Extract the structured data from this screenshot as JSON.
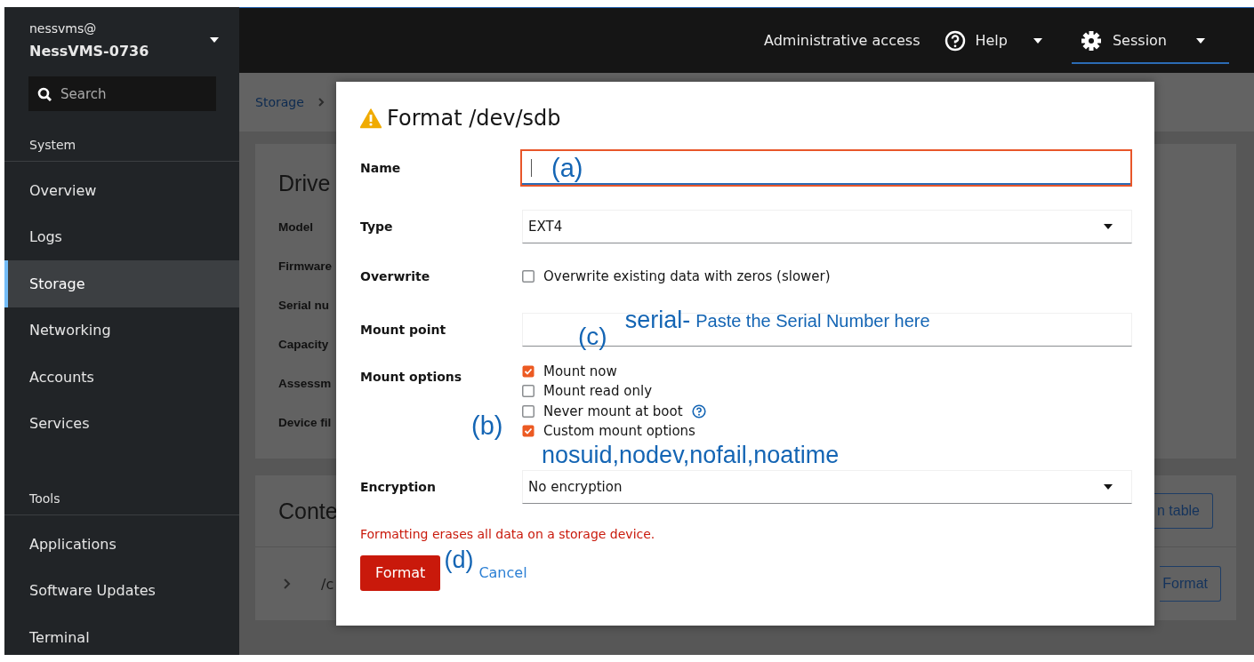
{
  "sidebar": {
    "user": "nessvms@",
    "host": "NessVMS-0736",
    "search": {
      "placeholder": "Search"
    },
    "sections": [
      {
        "heading": "System",
        "items": [
          {
            "label": "Overview",
            "selected": false
          },
          {
            "label": "Logs",
            "selected": false
          },
          {
            "label": "Storage",
            "selected": true
          },
          {
            "label": "Networking",
            "selected": false
          },
          {
            "label": "Accounts",
            "selected": false
          },
          {
            "label": "Services",
            "selected": false
          }
        ]
      },
      {
        "heading": "Tools",
        "items": [
          {
            "label": "Applications",
            "selected": false
          },
          {
            "label": "Software Updates",
            "selected": false
          },
          {
            "label": "Terminal",
            "selected": false
          }
        ]
      }
    ]
  },
  "topbar": {
    "admin": "Administrative access",
    "help": "Help",
    "session": "Session"
  },
  "page": {
    "breadcrumb": "Storage",
    "drive_card": {
      "title": "Drive",
      "labels": [
        "Model",
        "Firmware",
        "Serial nu",
        "Capacity",
        "Assessm",
        "Device fil"
      ]
    },
    "content_card": {
      "title": "Conte",
      "row": "/c",
      "buttons": [
        "n table",
        "Format"
      ]
    }
  },
  "dialog": {
    "title": "Format /dev/sdb",
    "fields": [
      {
        "kind": "text",
        "label": "Name",
        "invalid": true,
        "annotations": [
          "(a)"
        ]
      },
      {
        "kind": "select",
        "label": "Type",
        "value": "EXT4"
      },
      {
        "kind": "checkbox",
        "label": "Overwrite",
        "option": "Overwrite existing data with zeros (slower)",
        "checked": false
      },
      {
        "kind": "text",
        "label": "Mount point",
        "invalid": false,
        "annotations": [
          "(c)",
          "serial-",
          "Paste the Serial Number here"
        ]
      },
      {
        "kind": "checklist",
        "label": "Mount options",
        "annotation": "(b)",
        "note": "nosuid,nodev,nofail,noatime",
        "options": [
          {
            "label": "Mount now",
            "checked": true,
            "help": false
          },
          {
            "label": "Mount read only",
            "checked": false,
            "help": false
          },
          {
            "label": "Never mount at boot",
            "checked": false,
            "help": true
          },
          {
            "label": "Custom mount options",
            "checked": true,
            "help": false
          }
        ]
      },
      {
        "kind": "select",
        "label": "Encryption",
        "value": "No encryption"
      }
    ],
    "warning": "Formatting erases all data on a storage device.",
    "warning_annotation": "(d)",
    "buttons": [
      {
        "kind": "primary",
        "label": "Format"
      },
      {
        "kind": "link",
        "label": "Cancel"
      }
    ]
  }
}
